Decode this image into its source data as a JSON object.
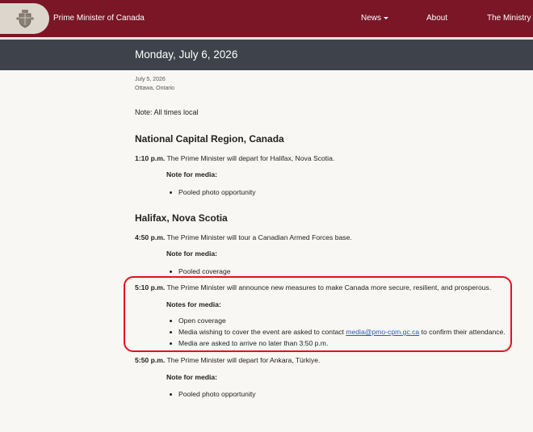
{
  "header": {
    "site_title": "Prime Minister of Canada",
    "nav": {
      "news": "News",
      "about": "About",
      "ministry": "The Ministry"
    }
  },
  "page": {
    "date_heading": "Monday, July 6, 2026",
    "release_date": "July 5, 2026",
    "location": "Ottawa, Ontario",
    "times_note": "Note: All times local"
  },
  "sections": [
    {
      "region": "National Capital Region, Canada",
      "items": [
        {
          "time": "1:10 p.m.",
          "text": "The Prime Minister will depart for Halifax, Nova Scotia.",
          "media_heading": "Note for media:",
          "notes": [
            "Pooled photo opportunity"
          ]
        }
      ]
    },
    {
      "region": "Halifax, Nova Scotia",
      "items": [
        {
          "time": "4:50 p.m.",
          "text": "The Prime Minister will tour a Canadian Armed Forces base.",
          "media_heading": "Note for media:",
          "notes": [
            "Pooled coverage"
          ]
        },
        {
          "time": "5:10 p.m.",
          "text": "The Prime Minister will announce new measures to make Canada more secure, resilient, and prosperous.",
          "media_heading": "Notes for media:",
          "notes": [
            "Open coverage",
            "Media are asked to arrive no later than 3:50 p.m."
          ],
          "contact_note": {
            "before": "Media wishing to cover the event are asked to contact ",
            "email": "media@pmo-cpm.gc.ca",
            "after": " to confirm their attendance."
          }
        },
        {
          "time": "5:50 p.m.",
          "text": "The Prime Minister will depart for Ankara, Türkiye.",
          "media_heading": "Note for media:",
          "notes": [
            "Pooled photo opportunity"
          ]
        }
      ]
    }
  ],
  "colors": {
    "header_bg": "#7a1626",
    "date_band_bg": "#3e434b",
    "highlight": "#e1131b",
    "link": "#2a5db0"
  }
}
